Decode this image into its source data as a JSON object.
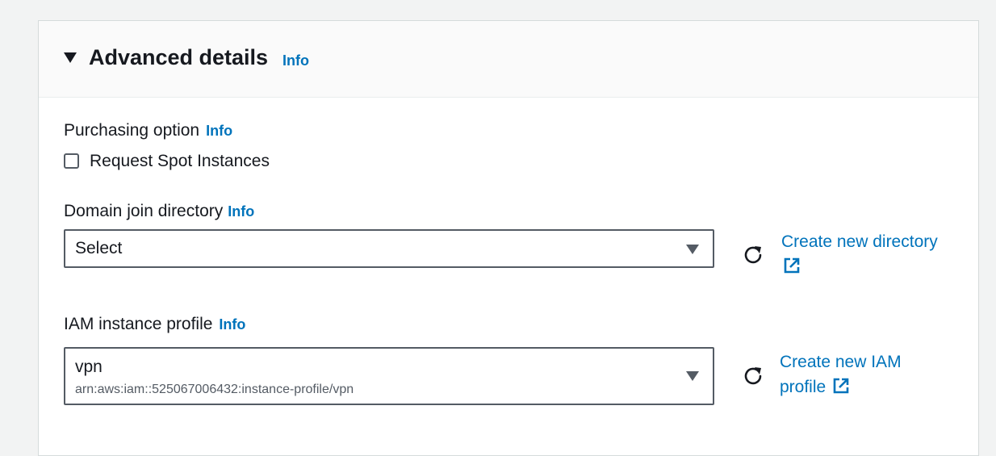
{
  "section": {
    "title": "Advanced details",
    "info_label": "Info"
  },
  "purchasing": {
    "label": "Purchasing option",
    "info_label": "Info",
    "checkbox_label": "Request Spot Instances",
    "checked": false
  },
  "domain_join": {
    "label": "Domain join directory",
    "info_label": "Info",
    "selected_value": "Select",
    "create_link_label": "Create new directory"
  },
  "iam_profile": {
    "label": "IAM instance profile",
    "info_label": "Info",
    "selected_value": "vpn",
    "selected_description": "arn:aws:iam::525067006432:instance-profile/vpn",
    "create_link_label": "Create new IAM profile"
  },
  "icons": {
    "toggle": "caret-down-icon",
    "select_caret": "caret-down-icon",
    "refresh": "refresh-icon",
    "external": "external-link-icon"
  },
  "colors": {
    "link": "#0073bb",
    "text": "#16191f",
    "border": "#545b64",
    "header_bg": "#fafafa",
    "page_bg": "#f2f3f3"
  }
}
